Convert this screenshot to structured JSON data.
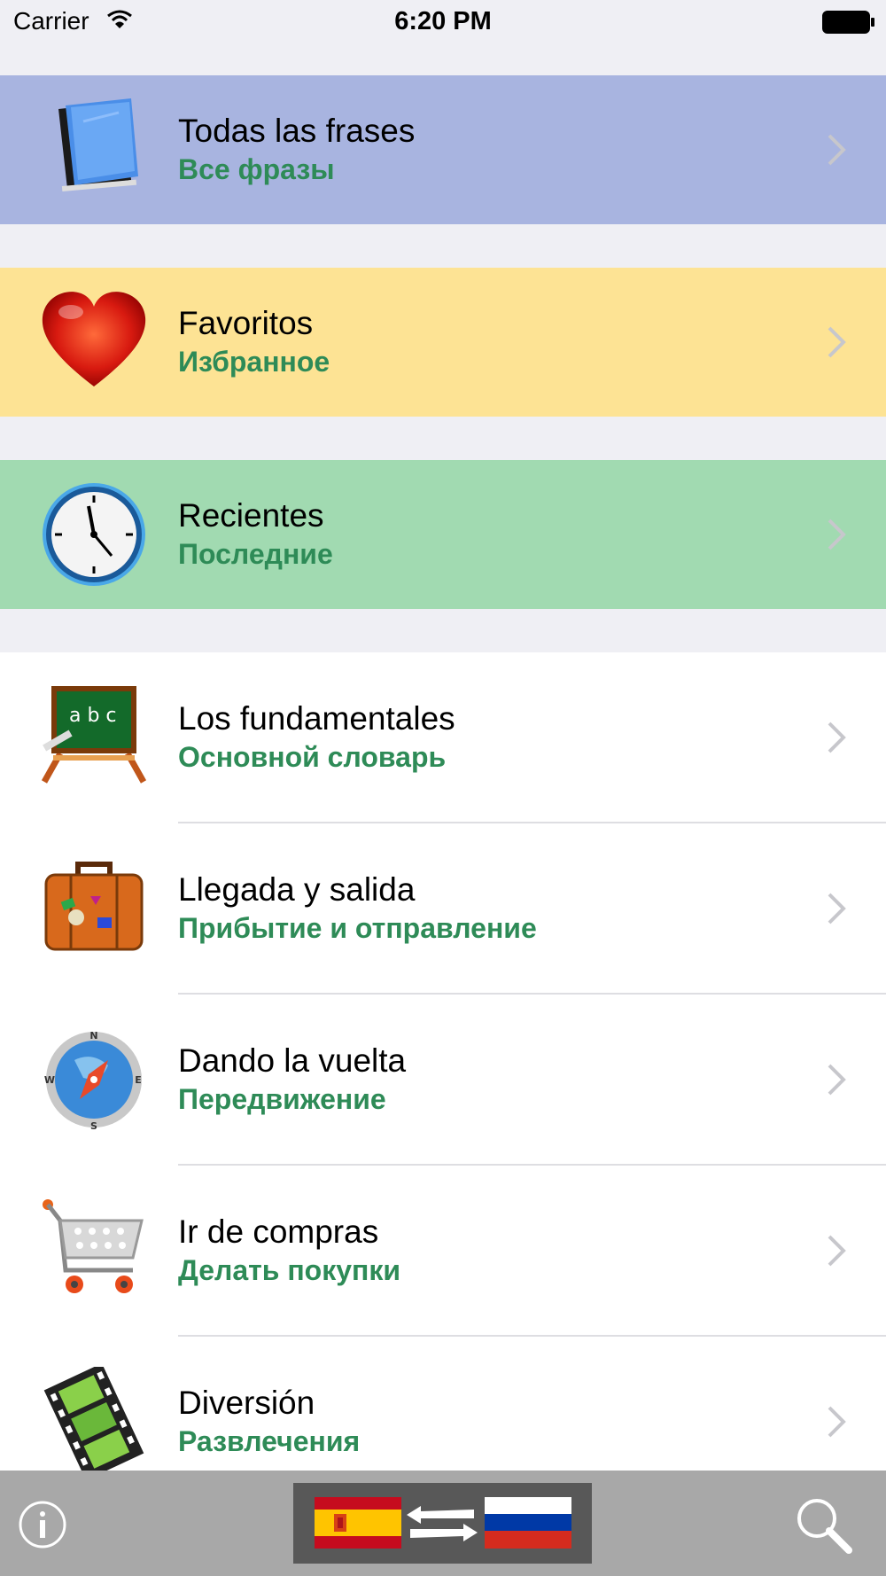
{
  "status_bar": {
    "carrier": "Carrier",
    "time": "6:20 PM"
  },
  "menu": [
    {
      "title": "Todas las frases",
      "subtitle": "Все фразы",
      "icon": "book-icon",
      "background": "#a8b4e0"
    },
    {
      "title": "Favoritos",
      "subtitle": "Избранное",
      "icon": "heart-icon",
      "background": "#fde394"
    },
    {
      "title": "Recientes",
      "subtitle": "Последние",
      "icon": "clock-icon",
      "background": "#a1dab1"
    },
    {
      "title": "Los fundamentales",
      "subtitle": "Основной словарь",
      "icon": "chalkboard-icon"
    },
    {
      "title": "Llegada y salida",
      "subtitle": "Прибытие и отправление",
      "icon": "suitcase-icon"
    },
    {
      "title": "Dando la vuelta",
      "subtitle": "Передвижение",
      "icon": "compass-icon"
    },
    {
      "title": "Ir de compras",
      "subtitle": "Делать покупки",
      "icon": "shopping-cart-icon"
    },
    {
      "title": "Diversión",
      "subtitle": "Развлечения",
      "icon": "film-reel-icon"
    }
  ],
  "toolbar": {
    "info_icon": "info-icon",
    "source_language_flag": "spain-flag-icon",
    "target_language_flag": "russia-flag-icon",
    "swap_icon": "swap-arrows-icon",
    "search_icon": "search-icon"
  },
  "colors": {
    "accent_green": "#2e8b57",
    "toolbar_gray": "#a8a8a8"
  }
}
